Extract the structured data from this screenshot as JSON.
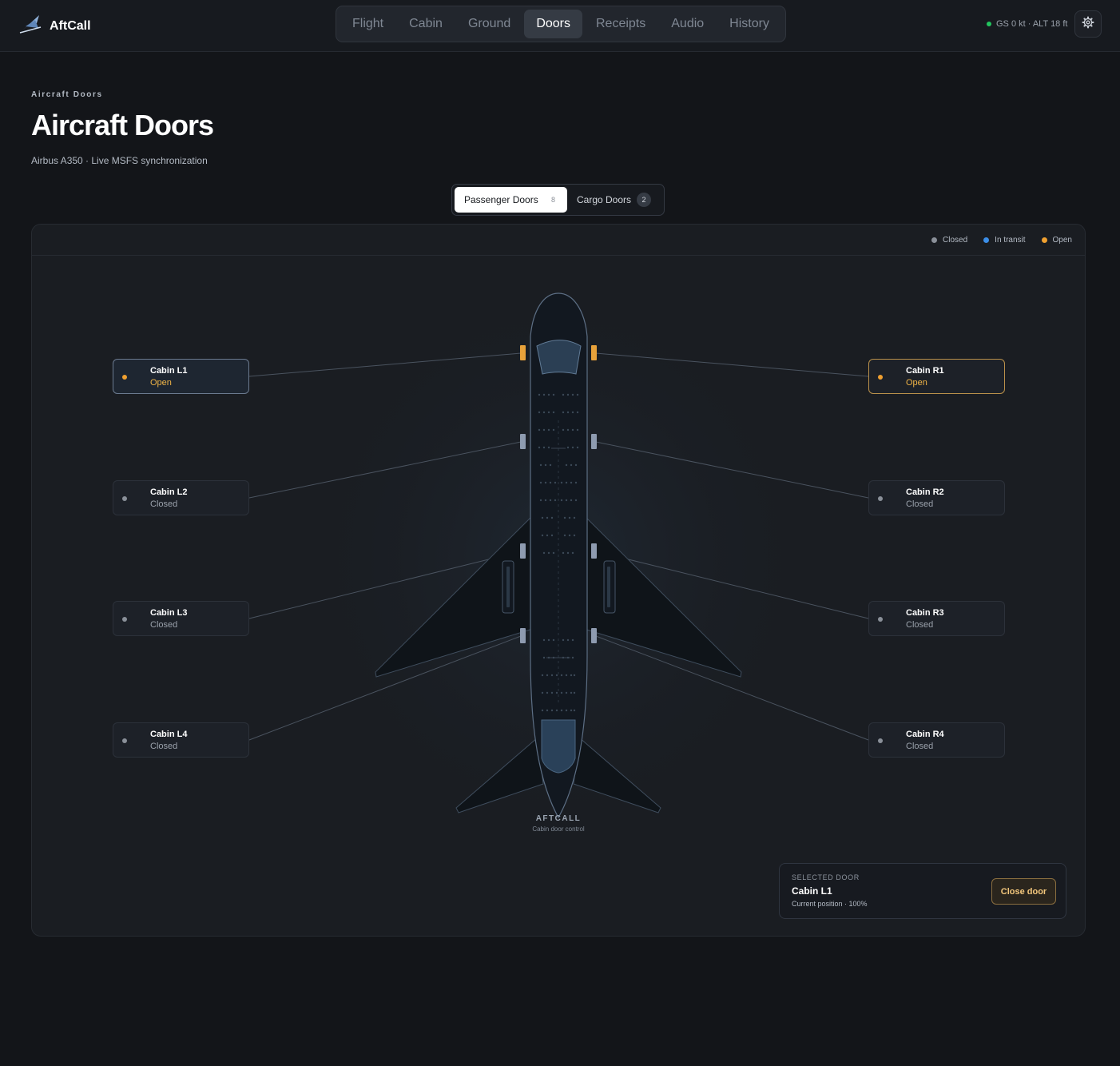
{
  "app": {
    "name": "AftCall"
  },
  "nav": {
    "tabs": [
      {
        "label": "Flight"
      },
      {
        "label": "Cabin"
      },
      {
        "label": "Ground"
      },
      {
        "label": "Doors"
      },
      {
        "label": "Receipts"
      },
      {
        "label": "Audio"
      },
      {
        "label": "History"
      }
    ],
    "active": "Doors"
  },
  "status": {
    "text": "GS 0 kt · ALT 18 ft",
    "color": "#22c55e"
  },
  "header": {
    "eyebrow": "Aircraft Doors",
    "title": "Aircraft Doors",
    "subtitle": "Airbus A350 · Live MSFS synchronization"
  },
  "segments": [
    {
      "label": "Passenger Doors",
      "count": "8"
    },
    {
      "label": "Cargo Doors",
      "count": "2"
    }
  ],
  "legend": [
    {
      "label": "Closed",
      "color": "#8a9099"
    },
    {
      "label": "In transit",
      "color": "#3b8ee8"
    },
    {
      "label": "Open",
      "color": "#f0a030"
    }
  ],
  "doors": {
    "L1": {
      "name": "Cabin L1",
      "state": "Open"
    },
    "L2": {
      "name": "Cabin L2",
      "state": "Closed"
    },
    "L3": {
      "name": "Cabin L3",
      "state": "Closed"
    },
    "L4": {
      "name": "Cabin L4",
      "state": "Closed"
    },
    "R1": {
      "name": "Cabin R1",
      "state": "Open"
    },
    "R2": {
      "name": "Cabin R2",
      "state": "Closed"
    },
    "R3": {
      "name": "Cabin R3",
      "state": "Closed"
    },
    "R4": {
      "name": "Cabin R4",
      "state": "Closed"
    }
  },
  "aircraft": {
    "brand": "AFTCALL",
    "caption": "Cabin door control"
  },
  "selected": {
    "label": "SELECTED DOOR",
    "name": "Cabin L1",
    "position": "Current position · 100%",
    "action": "Close door"
  },
  "colors": {
    "accent": "#f0a030",
    "closed": "#8a9099",
    "transit": "#3b8ee8"
  }
}
